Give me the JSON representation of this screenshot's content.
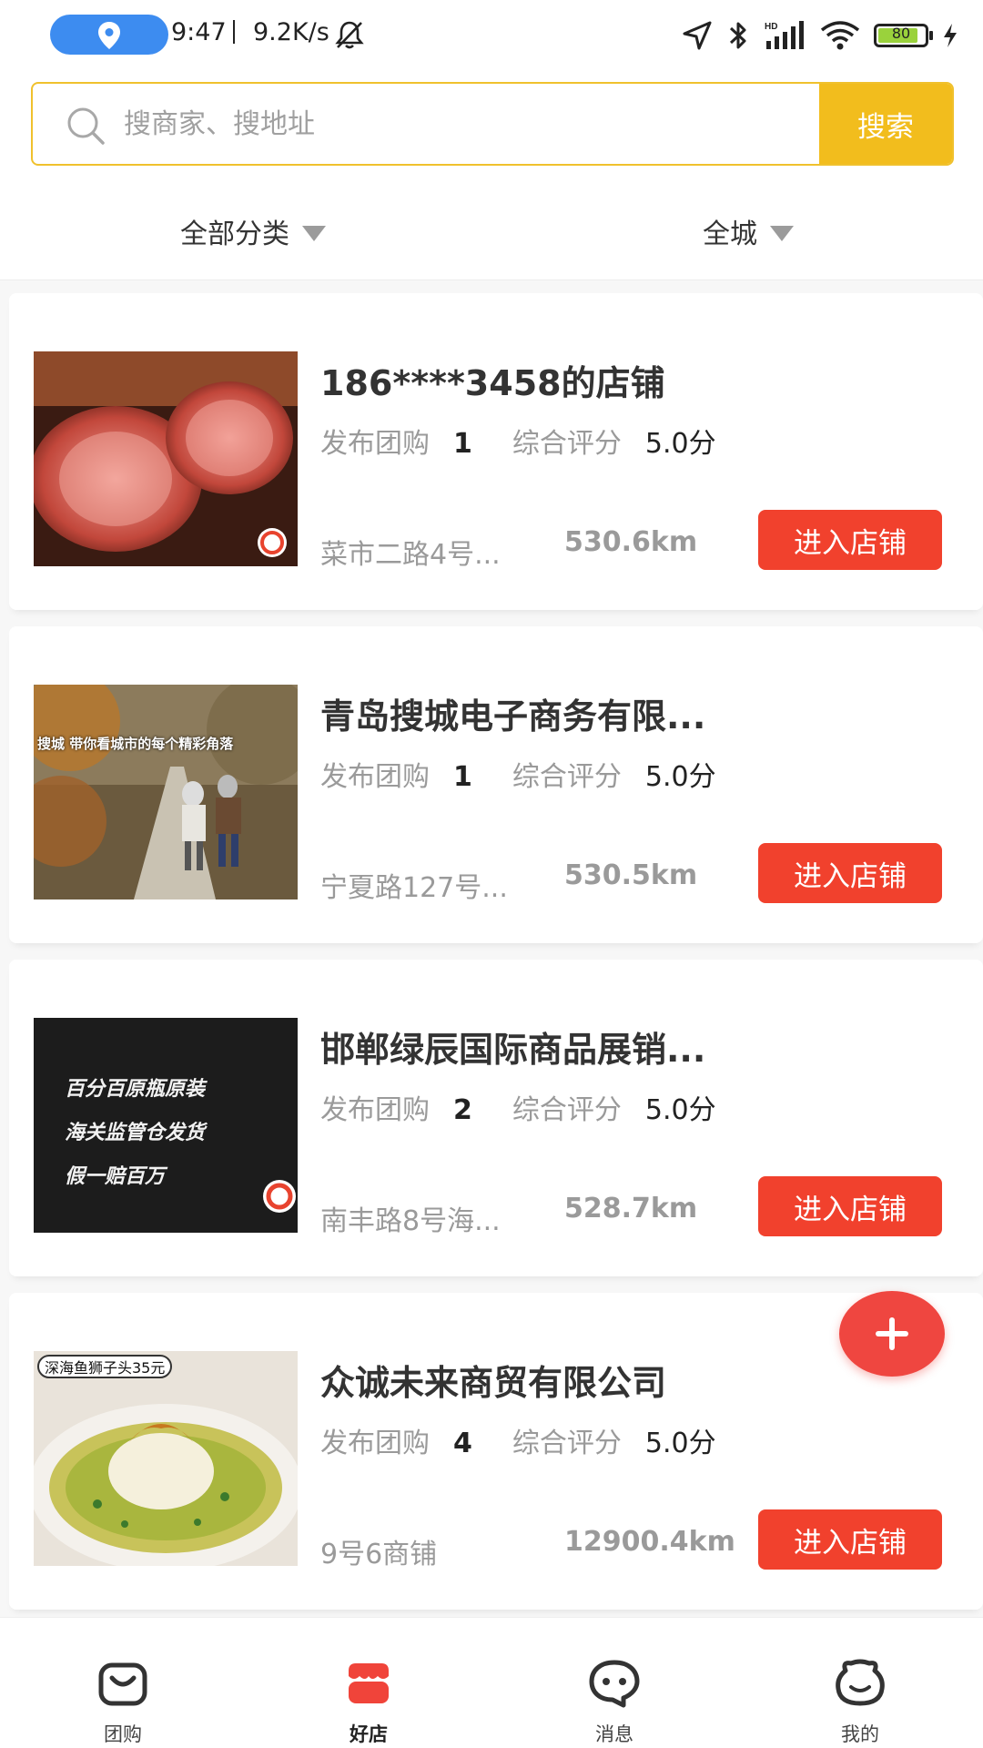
{
  "status_bar": {
    "time": "9:47",
    "speed": "9.2K/s",
    "battery": "80"
  },
  "search": {
    "placeholder": "搜商家、搜地址",
    "button": "搜索"
  },
  "filters": {
    "category": "全部分类",
    "area": "全城"
  },
  "shops": [
    {
      "name": "186****3458的店铺",
      "tuan_label": "发布团购",
      "tuan_count": "1",
      "rating_label": "综合评分",
      "rating": "5.0分",
      "address": "菜市二路4号...",
      "distance": "530.6km",
      "button": "进入店铺"
    },
    {
      "name": "青岛搜城电子商务有限...",
      "tuan_label": "发布团购",
      "tuan_count": "1",
      "rating_label": "综合评分",
      "rating": "5.0分",
      "address": "宁夏路127号...",
      "distance": "530.5km",
      "button": "进入店铺",
      "image_text": "搜城 带你看城市的每个精彩角落"
    },
    {
      "name": "邯郸绿辰国际商品展销...",
      "tuan_label": "发布团购",
      "tuan_count": "2",
      "rating_label": "综合评分",
      "rating": "5.0分",
      "address": "南丰路8号海...",
      "distance": "528.7km",
      "button": "进入店铺",
      "image_lines": [
        "百分百原瓶原装",
        "海关监管仓发货",
        "假一赔百万"
      ]
    },
    {
      "name": "众诚未来商贸有限公司",
      "tuan_label": "发布团购",
      "tuan_count": "4",
      "rating_label": "综合评分",
      "rating": "5.0分",
      "address": "9号6商铺",
      "distance": "12900.4km",
      "button": "进入店铺",
      "image_text": "深海鱼狮子头35元"
    }
  ],
  "tabs": [
    {
      "label": "团购",
      "icon": "bag-icon",
      "active": false
    },
    {
      "label": "好店",
      "icon": "shop-icon",
      "active": true
    },
    {
      "label": "消息",
      "icon": "chat-icon",
      "active": false
    },
    {
      "label": "我的",
      "icon": "face-icon",
      "active": false
    }
  ],
  "colors": {
    "accent_yellow": "#f2bd1d",
    "button_red": "#f1412d",
    "fab_red": "#ef4640",
    "active_tab": "#f0443a"
  }
}
